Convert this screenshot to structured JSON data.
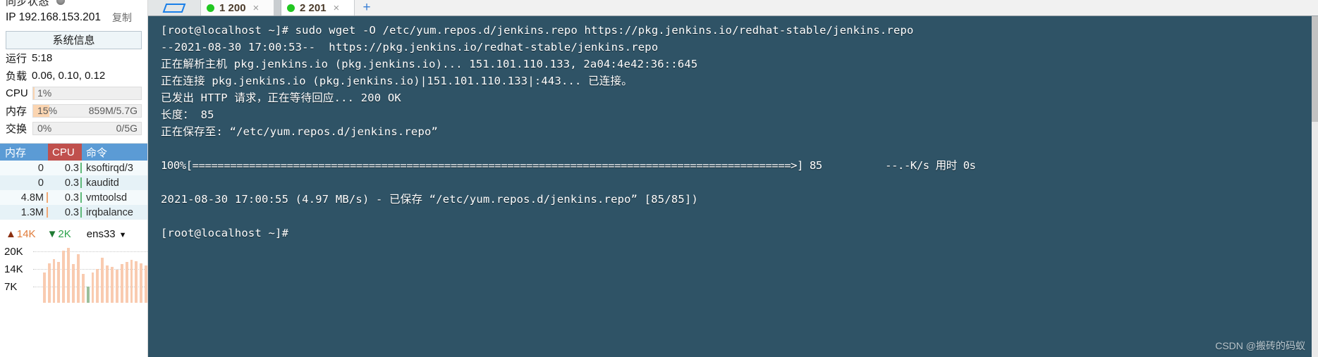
{
  "sidebar": {
    "sync_label": "同步状态",
    "sync_icon": "status-dot-icon",
    "ip_text": "IP 192.168.153.201",
    "copy_label": "复制",
    "sysinfo_button": "系统信息",
    "uptime_key": "运行",
    "uptime_value": "5:18",
    "load_key": "负载",
    "load_value": "0.06, 0.10, 0.12",
    "meters": [
      {
        "key": "CPU",
        "pct_text": "1%",
        "pct": 1,
        "right_text": "",
        "fill_color": "#fbd5b1"
      },
      {
        "key": "内存",
        "pct_text": "15%",
        "pct": 15,
        "right_text": "859M/5.7G",
        "fill_color": "#fbd5b1"
      },
      {
        "key": "交换",
        "pct_text": "0%",
        "pct": 0,
        "right_text": "0/5G",
        "fill_color": "#fbd5b1"
      }
    ],
    "process_table": {
      "headers": [
        "内存",
        "CPU",
        "命令"
      ],
      "header_colors": {
        "mem": "#5b9bd5",
        "cpu": "#c0504d",
        "cmd": "#5b9bd5"
      },
      "rows": [
        {
          "mem": "0",
          "cpu": "0.3",
          "cmd": "ksoftirqd/3"
        },
        {
          "mem": "0",
          "cpu": "0.3",
          "cmd": "kauditd"
        },
        {
          "mem": "4.8M",
          "cpu": "0.3",
          "cmd": "vmtoolsd"
        },
        {
          "mem": "1.3M",
          "cpu": "0.3",
          "cmd": "irqbalance"
        }
      ]
    },
    "network": {
      "up_arrow": "arrow-up-icon",
      "up_value": "14K",
      "down_arrow": "arrow-down-icon",
      "down_value": "2K",
      "interface": "ens33",
      "caret": "chevron-down-icon",
      "scale_labels": [
        "20K",
        "14K",
        "7K"
      ],
      "bar_color": "#f9cbb0",
      "bars": [
        0,
        0,
        0.55,
        0.72,
        0.8,
        0.74,
        0.95,
        1.0,
        0.7,
        0.88,
        0.52,
        0.3,
        0.55,
        0.62,
        0.82,
        0.68,
        0.66,
        0.6,
        0.7,
        0.74,
        0.78,
        0.76,
        0.72,
        0.68
      ]
    }
  },
  "tabbar": {
    "folder_icon": "folder-icon",
    "tabs": [
      {
        "status_icon": "green-dot-icon",
        "label": "1 200",
        "close_icon": "close-icon",
        "active": false
      },
      {
        "status_icon": "green-dot-icon",
        "label": "2 201",
        "close_icon": "close-icon",
        "active": true
      }
    ],
    "new_tab_icon": "plus-icon"
  },
  "terminal": {
    "background": "#2f5366",
    "foreground": "#ffffff",
    "lines": [
      "[root@localhost ~]# sudo wget -O /etc/yum.repos.d/jenkins.repo https://pkg.jenkins.io/redhat-stable/jenkins.repo",
      "--2021-08-30 17:00:53--  https://pkg.jenkins.io/redhat-stable/jenkins.repo",
      "正在解析主机 pkg.jenkins.io (pkg.jenkins.io)... 151.101.110.133, 2a04:4e42:36::645",
      "正在连接 pkg.jenkins.io (pkg.jenkins.io)|151.101.110.133|:443... 已连接。",
      "已发出 HTTP 请求，正在等待回应... 200 OK",
      "长度： 85",
      "正在保存至: “/etc/yum.repos.d/jenkins.repo”",
      "",
      "100%[===============================================================================================>] 85          --.-K/s 用时 0s",
      "",
      "2021-08-30 17:00:55 (4.97 MB/s) - 已保存 “/etc/yum.repos.d/jenkins.repo” [85/85])",
      "",
      "[root@localhost ~]#"
    ]
  },
  "watermark": "CSDN @搬砖的码蚁"
}
